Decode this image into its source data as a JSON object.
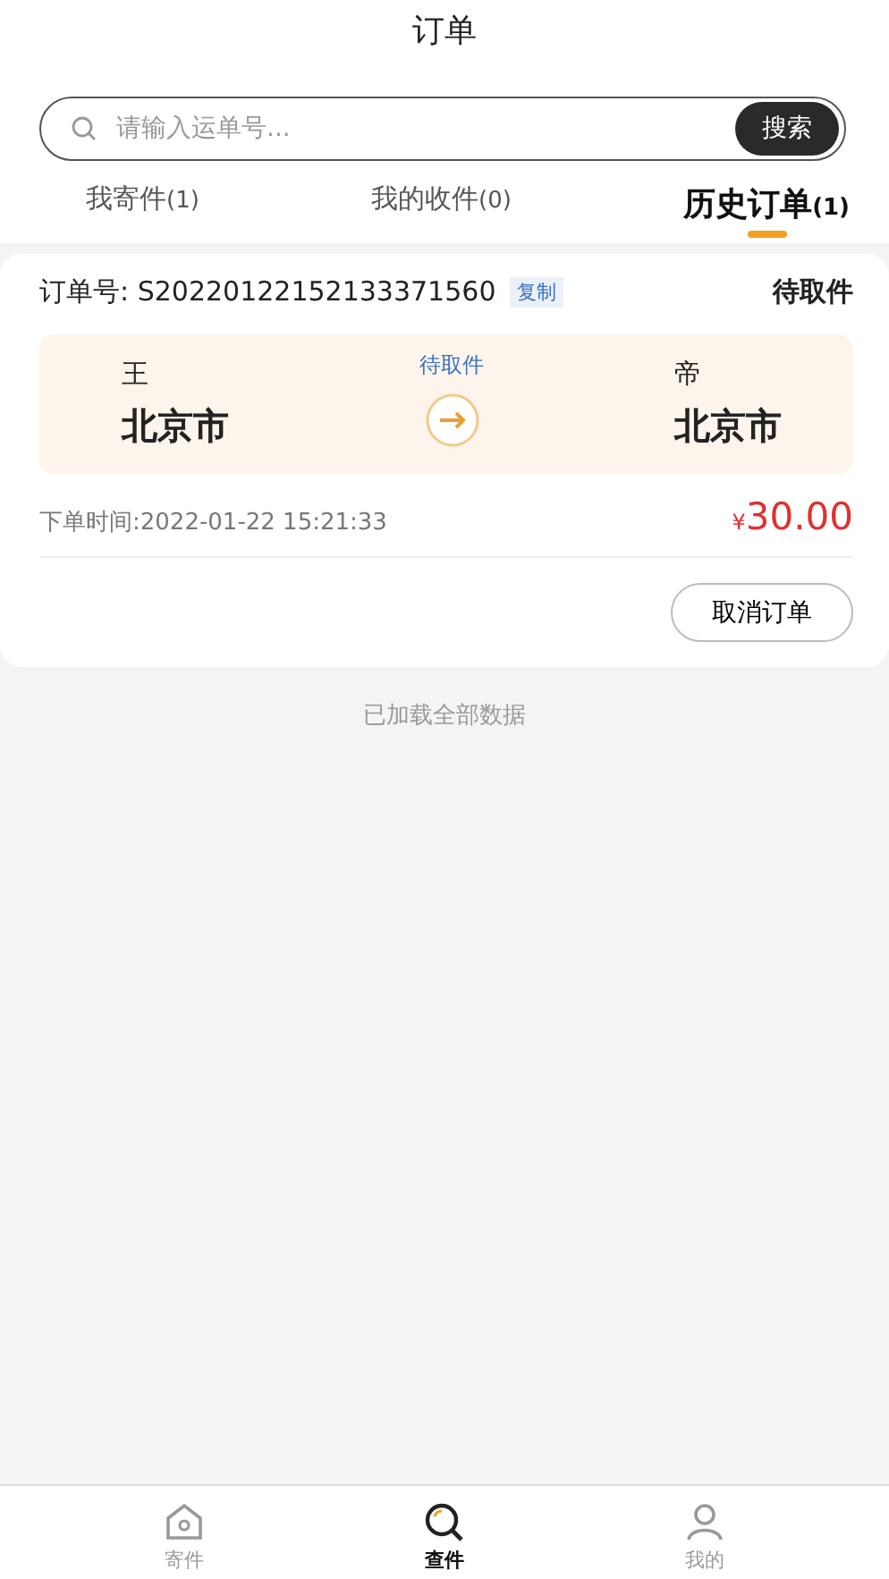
{
  "title": "订单",
  "search": {
    "placeholder": "请输入运单号...",
    "button": "搜索"
  },
  "tabs": [
    {
      "label": "我寄件",
      "count": "(1)",
      "selected": false
    },
    {
      "label": "我的收件",
      "count": "(0)",
      "selected": false
    },
    {
      "label": "历史订单",
      "count": "(1)",
      "selected": true
    }
  ],
  "orders": [
    {
      "order_label": "订单号:",
      "order_no": "S20220122152133371560",
      "copy": "复制",
      "status": "待取件",
      "sender": "王",
      "sender_city": "北京市",
      "route_status": "待取件",
      "receiver": "帝",
      "receiver_city": "北京市",
      "time": "下单时间:2022-01-22 15:21:33",
      "currency": "¥",
      "price": "30.00",
      "actions": [
        "取消订单"
      ]
    }
  ],
  "footer_note": "已加载全部数据",
  "nav": [
    {
      "kind": "home",
      "label": "寄件",
      "selected": false
    },
    {
      "kind": "search",
      "label": "查件",
      "selected": true
    },
    {
      "kind": "person",
      "label": "我的",
      "selected": false
    }
  ]
}
